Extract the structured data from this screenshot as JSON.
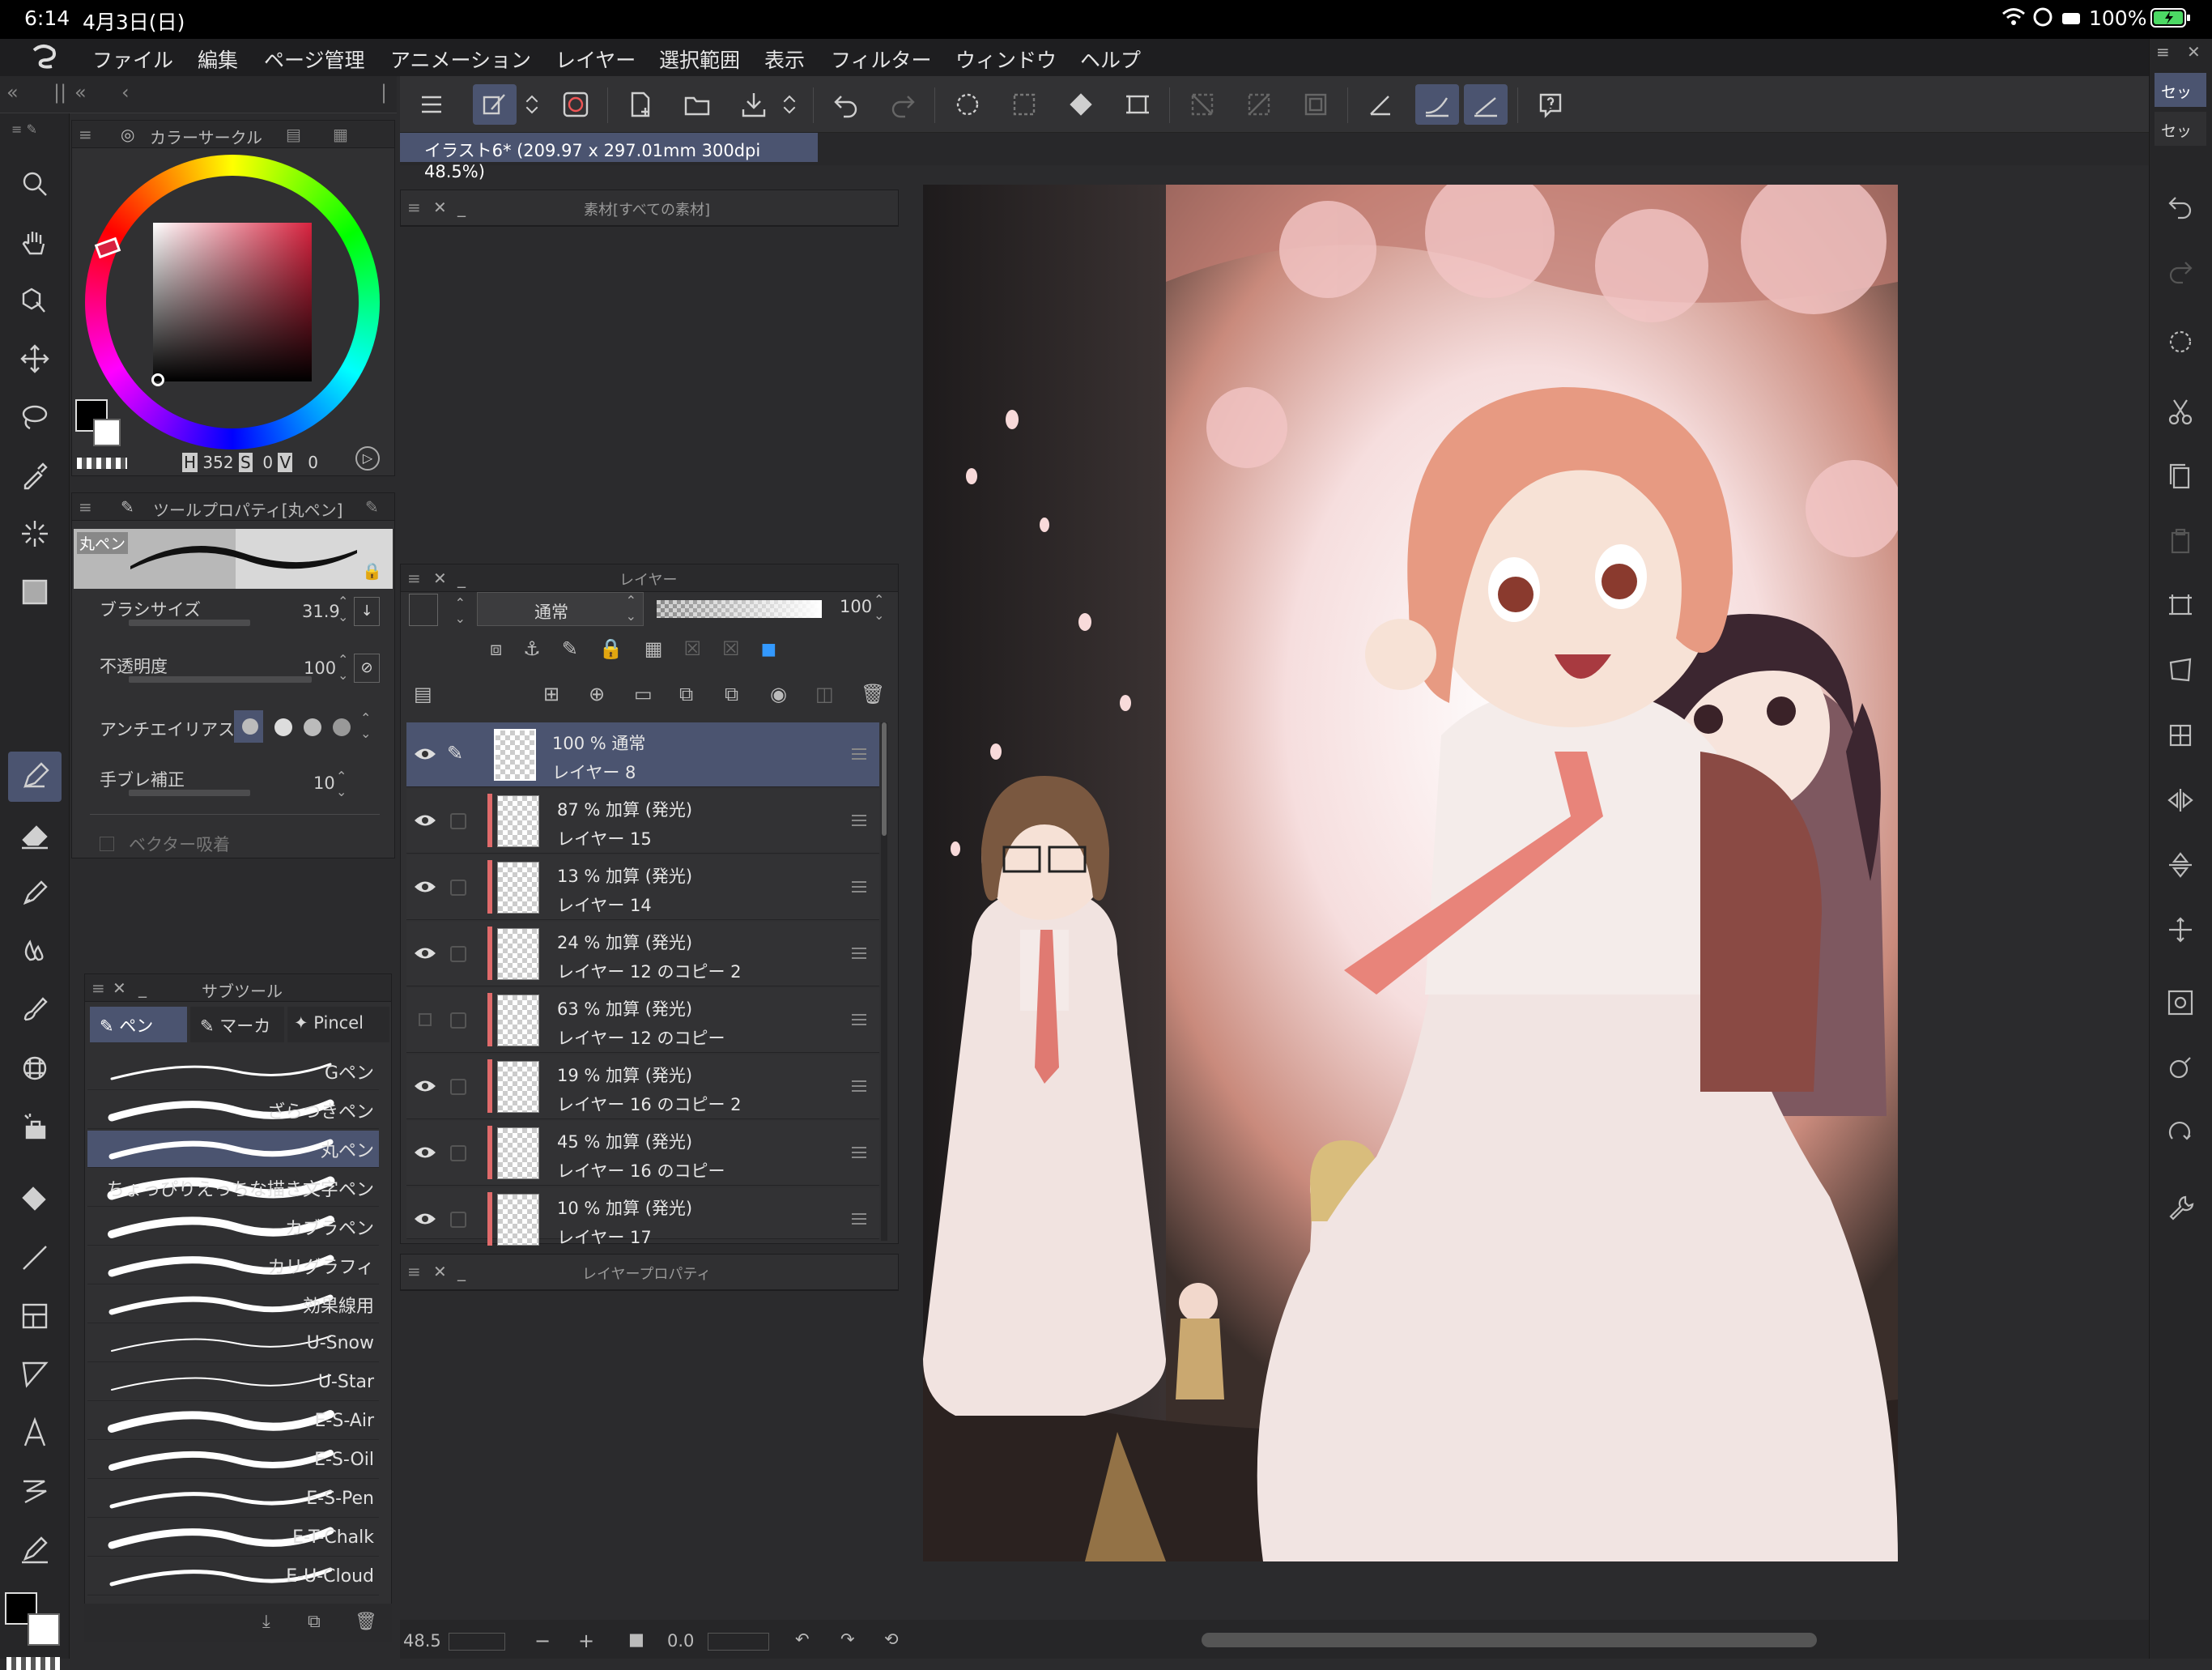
{
  "status_bar": {
    "time": "6:14",
    "date": "4月3日(日)",
    "battery": "100%"
  },
  "menu": [
    "ファイル",
    "編集",
    "ページ管理",
    "アニメーション",
    "レイヤー",
    "選択範囲",
    "表示",
    "フィルター",
    "ウィンドウ",
    "ヘルプ"
  ],
  "document_tab": "イラスト6* (209.97 x 297.01mm 300dpi 48.5%)",
  "right_tabs": [
    "セッ",
    "セッ"
  ],
  "color_panel": {
    "title": "カラーサークル",
    "h_label": "H",
    "h": "352",
    "s_label": "S",
    "s": "0",
    "v_label": "V",
    "v": "0"
  },
  "tool_property": {
    "title": "ツールプロパティ[丸ペン]",
    "preset": "丸ペン",
    "brush_size_label": "ブラシサイズ",
    "brush_size": "31.9",
    "opacity_label": "不透明度",
    "opacity": "100",
    "antialias_label": "アンチエイリアス",
    "stabilization_label": "手ブレ補正",
    "stabilization": "10",
    "vector_label": "ベクター吸着"
  },
  "material_panel": {
    "title": "素材[すべての素材]"
  },
  "layer_panel": {
    "title": "レイヤー",
    "blend_mode": "通常",
    "opacity": "100",
    "layers": [
      {
        "info": "100 % 通常",
        "name": "レイヤー 8",
        "selected": true
      },
      {
        "info": "87 % 加算 (発光)",
        "name": "レイヤー 15"
      },
      {
        "info": "13 % 加算 (発光)",
        "name": "レイヤー 14"
      },
      {
        "info": "24 % 加算 (発光)",
        "name": "レイヤー 12 のコピー 2"
      },
      {
        "info": "63 % 加算 (発光)",
        "name": "レイヤー 12 のコピー"
      },
      {
        "info": "19 % 加算 (発光)",
        "name": "レイヤー 16 のコピー 2"
      },
      {
        "info": "45 % 加算 (発光)",
        "name": "レイヤー 16 のコピー"
      },
      {
        "info": "10 % 加算 (発光)",
        "name": "レイヤー 17"
      }
    ]
  },
  "layer_property_panel": {
    "title": "レイヤープロパティ"
  },
  "subtool": {
    "title": "サブツール",
    "tabs": [
      "ペン",
      "マーカ",
      "Pincel"
    ],
    "brushes": [
      "Gペン",
      "ざらつきペン",
      "丸ペン",
      "ちょっぴりえっちな描き文字ペン",
      "カブラペン",
      "カリグラフィ",
      "効果線用",
      "U-Snow",
      "U-Star",
      "E-S-Air",
      "E-S-Oil",
      "E-S-Pen",
      "E-T-Chalk",
      "E-U-Cloud"
    ]
  },
  "bottom": {
    "zoom": "48.5",
    "rotation": "0.0",
    "minus": "−",
    "plus": "+"
  }
}
